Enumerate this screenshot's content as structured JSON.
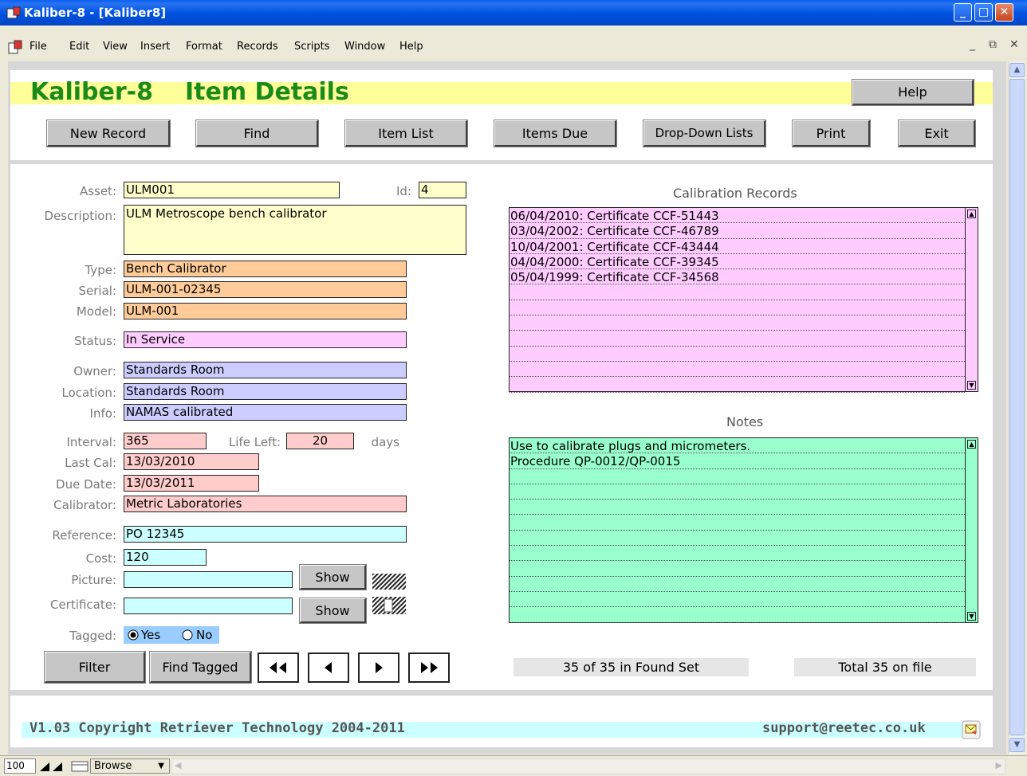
{
  "window": {
    "title": "Kaliber-8 - [Kaliber8]"
  },
  "menu": [
    "File",
    "Edit",
    "View",
    "Insert",
    "Format",
    "Records",
    "Scripts",
    "Window",
    "Help"
  ],
  "header": {
    "app_name": "Kaliber-8",
    "page_name": "Item Details",
    "help_label": "Help",
    "buttons": [
      "New Record",
      "Find",
      "Item List",
      "Items Due",
      "Drop-Down Lists",
      "Print",
      "Exit"
    ]
  },
  "form": {
    "asset_label": "Asset:",
    "asset": "ULM001",
    "id_label": "Id:",
    "id": "4",
    "description_label": "Description:",
    "description": "ULM Metroscope bench calibrator",
    "type_label": "Type:",
    "type": "Bench Calibrator",
    "serial_label": "Serial:",
    "serial": "ULM-001-02345",
    "model_label": "Model:",
    "model": "ULM-001",
    "status_label": "Status:",
    "status": "In Service",
    "owner_label": "Owner:",
    "owner": "Standards Room",
    "location_label": "Location:",
    "location": "Standards Room",
    "info_label": "Info:",
    "info": "NAMAS calibrated",
    "interval_label": "Interval:",
    "interval": "365",
    "life_left_label": "Life Left:",
    "life_left": "20",
    "days_label": "days",
    "last_cal_label": "Last Cal:",
    "last_cal": "13/03/2010",
    "due_date_label": "Due Date:",
    "due_date": "13/03/2011",
    "calibrator_label": "Calibrator:",
    "calibrator": "Metric Laboratories",
    "reference_label": "Reference:",
    "reference": "PO 12345",
    "cost_label": "Cost:",
    "cost": "120",
    "picture_label": "Picture:",
    "picture": "",
    "certificate_label": "Certificate:",
    "certificate": "",
    "show_label": "Show",
    "tagged_label": "Tagged:",
    "tagged_yes": "Yes",
    "tagged_no": "No",
    "tagged_value": "Yes"
  },
  "calibration": {
    "title": "Calibration  Records",
    "records": [
      "06/04/2010: Certificate CCF-51443",
      "03/04/2002: Certificate CCF-46789",
      "10/04/2001: Certificate CCF-43444",
      "04/04/2000: Certificate CCF-39345",
      "05/04/1999: Certificate CCF-34568"
    ]
  },
  "notes": {
    "title": "Notes",
    "lines": [
      "Use to calibrate plugs and micrometers.",
      "Procedure QP-0012/QP-0015"
    ]
  },
  "bottom": {
    "filter_label": "Filter",
    "find_tagged_label": "Find Tagged",
    "found_set": "35 of 35 in Found Set",
    "total": "Total 35 on file"
  },
  "footer": {
    "copyright": "V1.03 Copyright Retriever Technology 2004-2011",
    "support": "support@reetec.co.uk"
  },
  "statusbar": {
    "zoom": "100",
    "mode": "Browse"
  },
  "colors": {
    "heading_green": "#1a8a1a",
    "header_yellow": "#ffff99",
    "asset_yellow": "#ffffcc",
    "type_orange": "#ffcc99",
    "status_pink": "#ffccff",
    "owner_blue": "#ccccff",
    "cal_red": "#ffcccc",
    "ref_cyan": "#ccffff",
    "notes_green": "#99ffcc",
    "tagged_blue": "#99ccff"
  }
}
